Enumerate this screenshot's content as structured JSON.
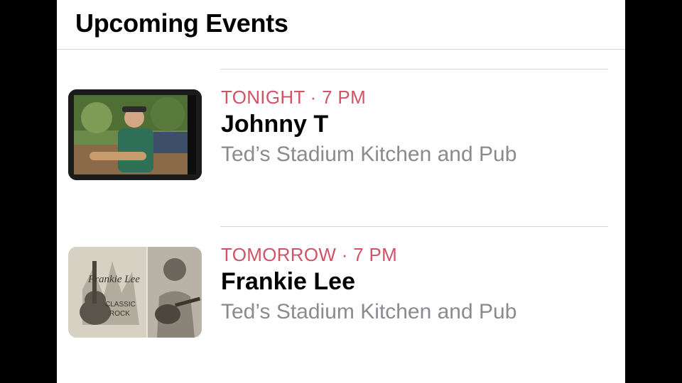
{
  "header": {
    "title": "Upcoming Events"
  },
  "events": [
    {
      "when": "TONIGHT · 7 PM",
      "performer": "Johnny T",
      "venue": "Ted’s Stadium Kitchen and Pub"
    },
    {
      "when": "TOMORROW · 7 PM",
      "performer": "Frankie Lee",
      "venue": "Ted’s Stadium Kitchen and Pub",
      "poster_text": [
        "Frankie Lee",
        "CLASSIC",
        "ROCK"
      ]
    }
  ],
  "colors": {
    "accent": "#d05366",
    "secondary_text": "#8a8a8f",
    "separator": "#d6d6d6"
  }
}
